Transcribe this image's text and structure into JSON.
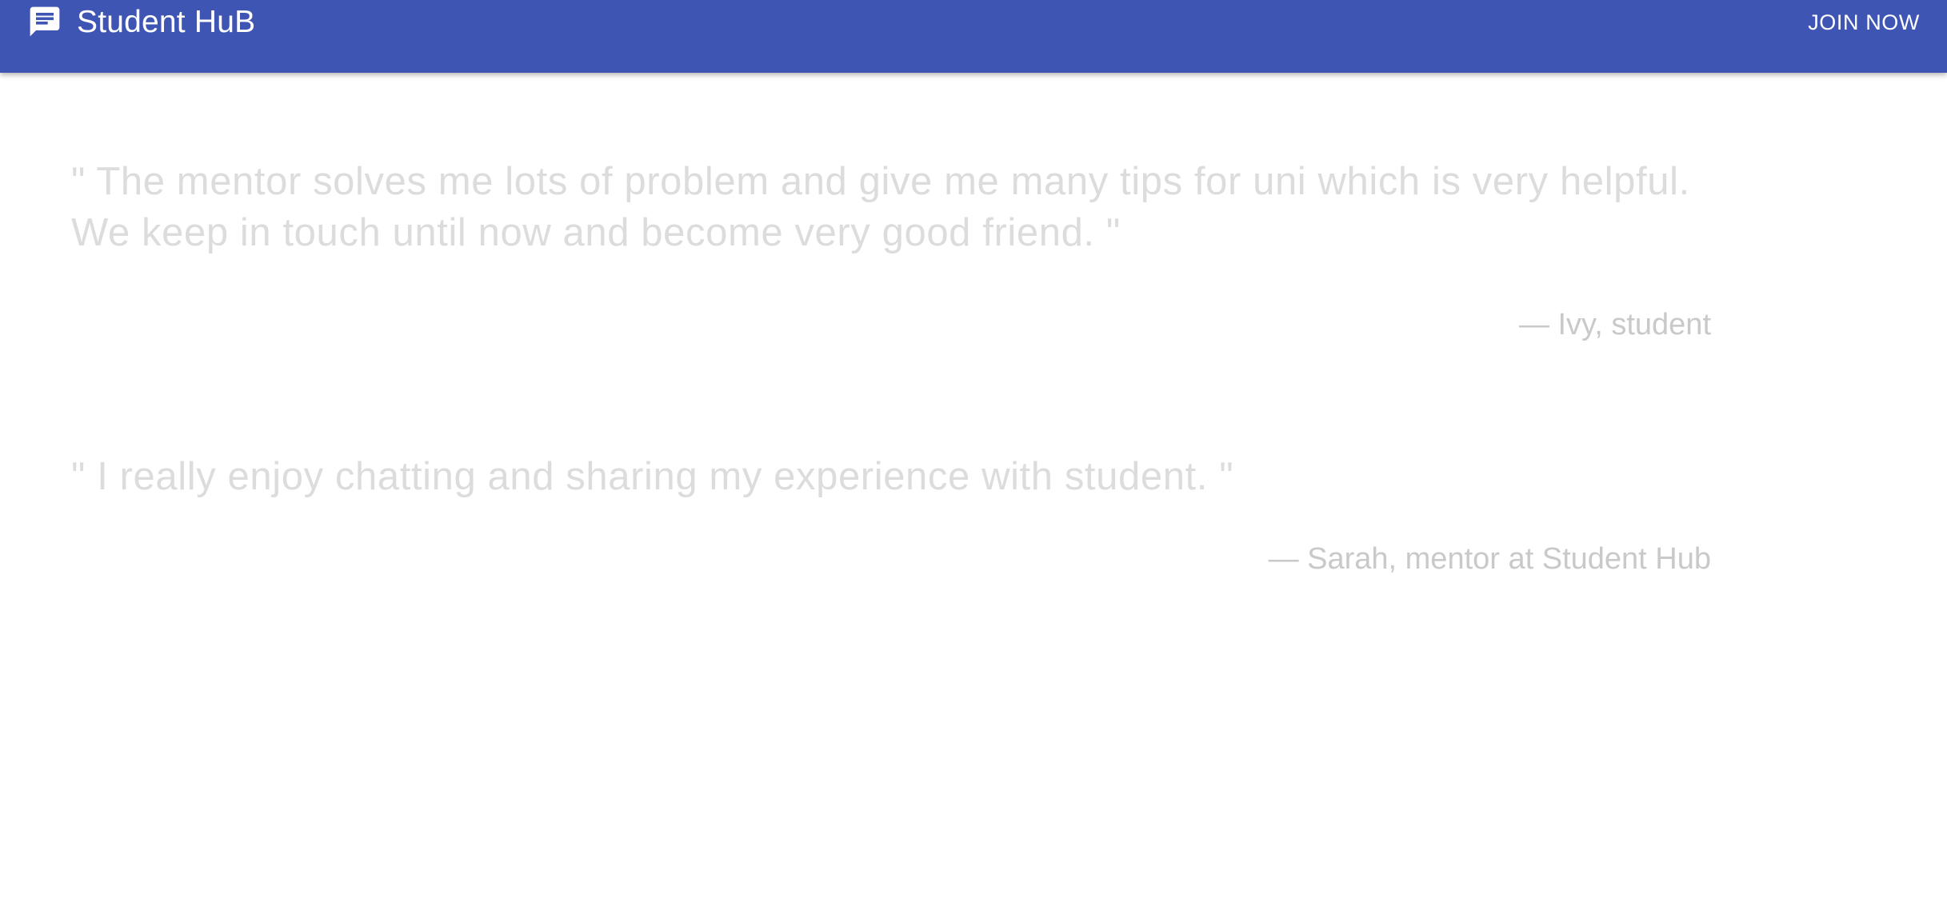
{
  "appbar": {
    "icon": "chat-message-icon",
    "title": "Student HuB",
    "join_label": "JOIN NOW",
    "background_color": "#3f55b4"
  },
  "testimonials": [
    {
      "text": "\" The mentor solves me lots of problem and give me many tips for uni which is very helpful. We keep in touch until now and become very good friend. \"",
      "author": "— Ivy, student"
    },
    {
      "text": "\" I really enjoy chatting and sharing my experience with student. \"",
      "author": "— Sarah, mentor at Student Hub"
    }
  ],
  "colors": {
    "quote_text": "#dcdcdc",
    "quote_author": "#c9c9c9"
  }
}
